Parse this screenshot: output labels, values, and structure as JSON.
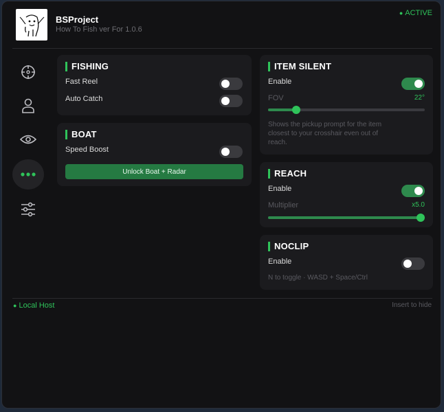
{
  "header": {
    "title": "BSProject",
    "subtitle": "How To Fish ver For 1.0.6",
    "status": "ACTIVE",
    "logo": "ghost-doodle-logo"
  },
  "sidebar": {
    "items": [
      {
        "icon": "crosshair-icon"
      },
      {
        "icon": "user-icon"
      },
      {
        "icon": "eye-icon"
      },
      {
        "icon": "more-dots-icon",
        "active": true
      },
      {
        "icon": "sliders-icon"
      }
    ]
  },
  "fishing": {
    "title": "FISHING",
    "fast_reel": {
      "label": "Fast Reel",
      "enabled": false
    },
    "auto_catch": {
      "label": "Auto Catch",
      "enabled": false
    }
  },
  "boat": {
    "title": "BOAT",
    "speed_boost": {
      "label": "Speed Boost",
      "enabled": false
    },
    "unlock_button": "Unlock Boat + Radar"
  },
  "item_silent": {
    "title": "ITEM SILENT",
    "enable": {
      "label": "Enable",
      "enabled": true
    },
    "fov_label": "FOV",
    "fov_value": "22°",
    "fov_level": 0.18,
    "description": "Shows the pickup prompt for the item closest to your crosshair even out of reach."
  },
  "reach": {
    "title": "REACH",
    "enable": {
      "label": "Enable",
      "enabled": true
    },
    "multiplier_label": "Multiplier",
    "multiplier_value": "x5.0",
    "multiplier_level": 1.0
  },
  "noclip": {
    "title": "NOCLIP",
    "enable": {
      "label": "Enable",
      "enabled": false
    },
    "hint": "N to toggle · WASD + Space/Ctrl"
  },
  "footer": {
    "left": "Local Host",
    "right": "Insert to hide"
  },
  "colors": {
    "accent": "#2fc35a",
    "panel": "#1b1b1e",
    "background": "#121214"
  }
}
